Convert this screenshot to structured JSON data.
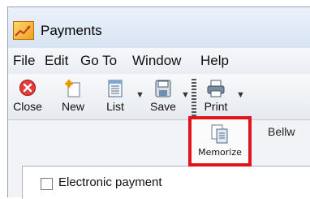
{
  "window": {
    "title": "Payments",
    "icon": "payments-chart-icon"
  },
  "menu": {
    "items": [
      {
        "label": "File"
      },
      {
        "label": "Edit"
      },
      {
        "label": "Go To"
      },
      {
        "label": "Window"
      },
      {
        "label": "Help"
      }
    ]
  },
  "toolbar": {
    "close_label": "Close",
    "new_label": "New",
    "list_label": "List",
    "save_label": "Save",
    "print_label": "Print",
    "memorize_label": "Memorize"
  },
  "form": {
    "electronic_payment_label": "Electronic payment",
    "electronic_payment_checked": false,
    "payee_fragment": "Bellw"
  },
  "colors": {
    "highlight_border": "#e0141e",
    "close_icon_red": "#e23d3d"
  }
}
